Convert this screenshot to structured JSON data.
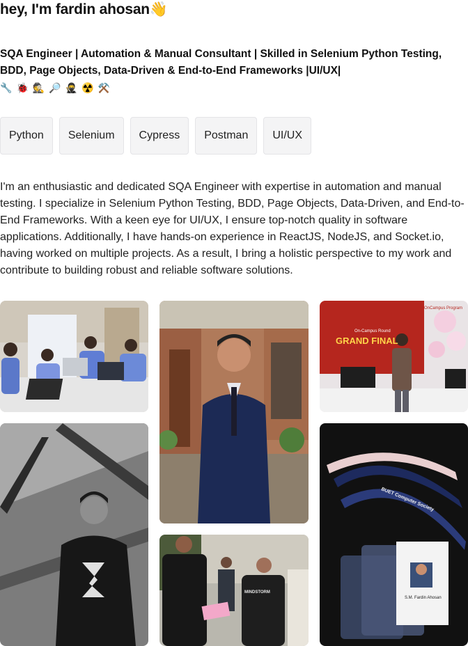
{
  "header": {
    "name": "hey, I'm fardin ahosan",
    "wave": "👋"
  },
  "headline": "SQA Engineer | Automation & Manual Consultant | Skilled in Selenium Python Testing, BDD, Page Objects, Data-Driven & End-to-End Frameworks |UI/UX|",
  "emojis": [
    "🔧",
    "🐞",
    "🕵️",
    "🔎",
    "🥷",
    "☢️",
    "⚒️"
  ],
  "skills": [
    "Python",
    "Selenium",
    "Cypress",
    "Postman",
    "UI/UX"
  ],
  "about": "I'm an enthusiastic and dedicated SQA Engineer with expertise in automation and manual testing. I specialize in Selenium Python Testing, BDD, Page Objects, Data-Driven, and End-to-End Frameworks. With a keen eye for UI/UX, I ensure top-notch quality in software applications. Additionally, I have hands-on experience in ReactJS, NodeJS, and Socket.io, having worked on multiple projects. As a result, I bring a holistic perspective to my work and contribute to building robust and reliable software solutions.",
  "gallery": {
    "banner_text": "GRAND FINAL",
    "banner_small_1": "On-Campus Round",
    "banner_small_2": "OnCampus Program",
    "jacket_text": "MINDSTORM",
    "lanyard_text": "BUET Computer Society",
    "id_card_name": "S.M. Fardin Ahosan"
  }
}
